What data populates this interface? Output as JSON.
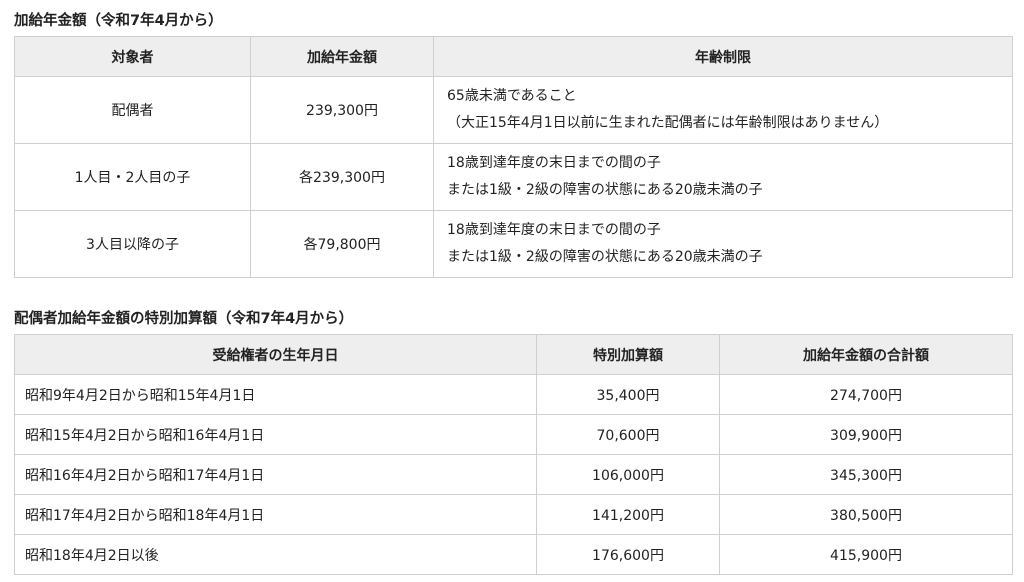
{
  "table1": {
    "title": "加給年金額（令和7年4月から）",
    "headers": [
      "対象者",
      "加給年金額",
      "年齢制限"
    ],
    "rows": [
      {
        "target": "配偶者",
        "amount": "239,300円",
        "limit_lines": [
          "65歳未満であること",
          "（大正15年4月1日以前に生まれた配偶者には年齢制限はありません）"
        ]
      },
      {
        "target": "1人目・2人目の子",
        "amount": "各239,300円",
        "limit_lines": [
          "18歳到達年度の末日までの間の子",
          "または1級・2級の障害の状態にある20歳未満の子"
        ]
      },
      {
        "target": "3人目以降の子",
        "amount": "各79,800円",
        "limit_lines": [
          "18歳到達年度の末日までの間の子",
          "または1級・2級の障害の状態にある20歳未満の子"
        ]
      }
    ]
  },
  "table2": {
    "title": "配偶者加給年金額の特別加算額（令和7年4月から）",
    "headers": [
      "受給権者の生年月日",
      "特別加算額",
      "加給年金額の合計額"
    ],
    "rows": [
      {
        "birth": "昭和9年4月2日から昭和15年4月1日",
        "special": "35,400円",
        "total": "274,700円"
      },
      {
        "birth": "昭和15年4月2日から昭和16年4月1日",
        "special": "70,600円",
        "total": "309,900円"
      },
      {
        "birth": "昭和16年4月2日から昭和17年4月1日",
        "special": "106,000円",
        "total": "345,300円"
      },
      {
        "birth": "昭和17年4月2日から昭和18年4月1日",
        "special": "141,200円",
        "total": "380,500円"
      },
      {
        "birth": "昭和18年4月2日以後",
        "special": "176,600円",
        "total": "415,900円"
      }
    ]
  }
}
